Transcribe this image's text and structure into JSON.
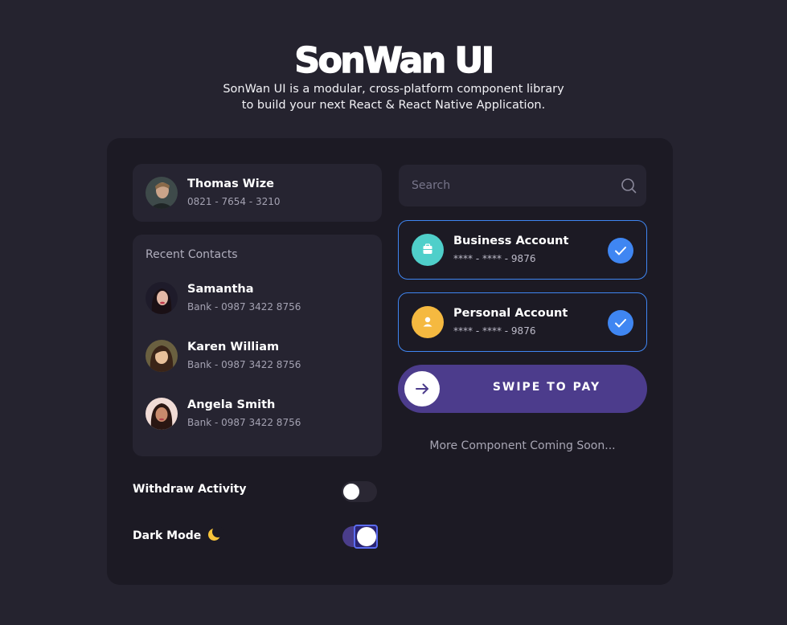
{
  "header": {
    "brand": "SonWan UI",
    "tagline_line1": "SonWan UI is a modular, cross-platform component library",
    "tagline_line2": "to build your next React & React Native Application."
  },
  "profile": {
    "name": "Thomas Wize",
    "phone": "0821 - 7654 - 3210"
  },
  "recent_contacts": {
    "title": "Recent Contacts",
    "items": [
      {
        "name": "Samantha",
        "detail": "Bank - 0987 3422 8756"
      },
      {
        "name": "Karen William",
        "detail": "Bank - 0987 3422 8756"
      },
      {
        "name": "Angela Smith",
        "detail": "Bank - 0987 3422 8756"
      }
    ]
  },
  "toggles": {
    "withdraw": {
      "label": "Withdraw Activity",
      "on": false
    },
    "dark_mode": {
      "label": "Dark Mode",
      "icon": "moon-icon",
      "on": true
    }
  },
  "search": {
    "placeholder": "Search",
    "value": "",
    "icon": "search-icon"
  },
  "accounts": [
    {
      "name": "Business Account",
      "number": "**** - **** - 9876",
      "icon": "briefcase-icon",
      "color": "#4fcfca",
      "selected": true
    },
    {
      "name": "Personal Account",
      "number": "**** - **** - 9876",
      "icon": "user-icon",
      "color": "#f5b940",
      "selected": true
    }
  ],
  "swipe": {
    "label": "SWIPE TO PAY",
    "icon": "arrow-right-icon"
  },
  "footer_note": "More Component Coming Soon...",
  "colors": {
    "background": "#25232f",
    "card": "#1c1a24",
    "panel": "#262431",
    "accent_blue": "#3f86f2",
    "accent_purple": "#4c3c8c"
  }
}
